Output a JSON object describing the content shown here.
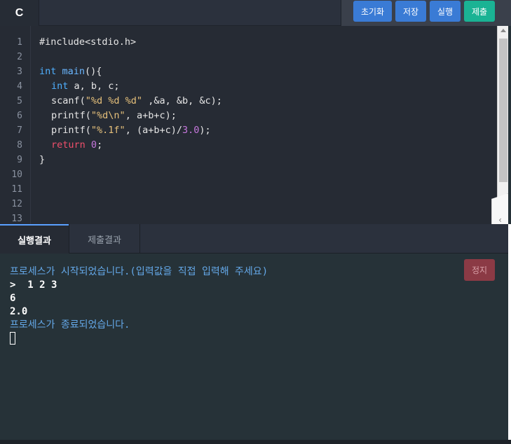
{
  "header": {
    "language_tab": "C",
    "buttons": {
      "reset": "초기화",
      "save": "저장",
      "run": "실행",
      "submit": "제출"
    }
  },
  "editor": {
    "line_numbers": [
      "1",
      "2",
      "3",
      "4",
      "5",
      "6",
      "7",
      "8",
      "9",
      "10",
      "11",
      "12",
      "13"
    ],
    "code": {
      "l1": "#include<stdio.h>",
      "l3_kw": "int",
      "l3_fn": "main",
      "l3_rest": "(){",
      "l4_kw": "int",
      "l4_rest": " a, b, c;",
      "l5_a": "scanf(",
      "l5_str": "\"%d %d %d\"",
      "l5_b": " ,&a, &b, &c);",
      "l6_a": "printf(",
      "l6_str": "\"%d\\n\"",
      "l6_b": ", a+b+c);",
      "l7_a": "printf(",
      "l7_str": "\"%.1f\"",
      "l7_b": ", (a+b+c)/",
      "l7_num": "3.0",
      "l7_c": ");",
      "l8_kw": "return",
      "l8_num": "0",
      "l8_rest": ";",
      "l9": "}"
    }
  },
  "result_tabs": {
    "run_result": "실행결과",
    "submit_result": "제출결과"
  },
  "console": {
    "started": "프로세스가 시작되었습니다.(입력값을 직접 입력해 주세요)",
    "input_line": ">  1 2 3",
    "out1": "6",
    "out2": "2.0",
    "ended": "프로세스가 종료되었습니다.",
    "stop_button": "정지"
  },
  "colors": {
    "accent_blue": "#3a7bd5",
    "submit_green": "#1ab394",
    "stop_red": "#8b3a45",
    "editor_bg": "#262b34",
    "console_info": "#64a8e8"
  },
  "icons": {
    "scroll_up": "triangle-up-icon",
    "collapse": "chevron-left-icon"
  }
}
